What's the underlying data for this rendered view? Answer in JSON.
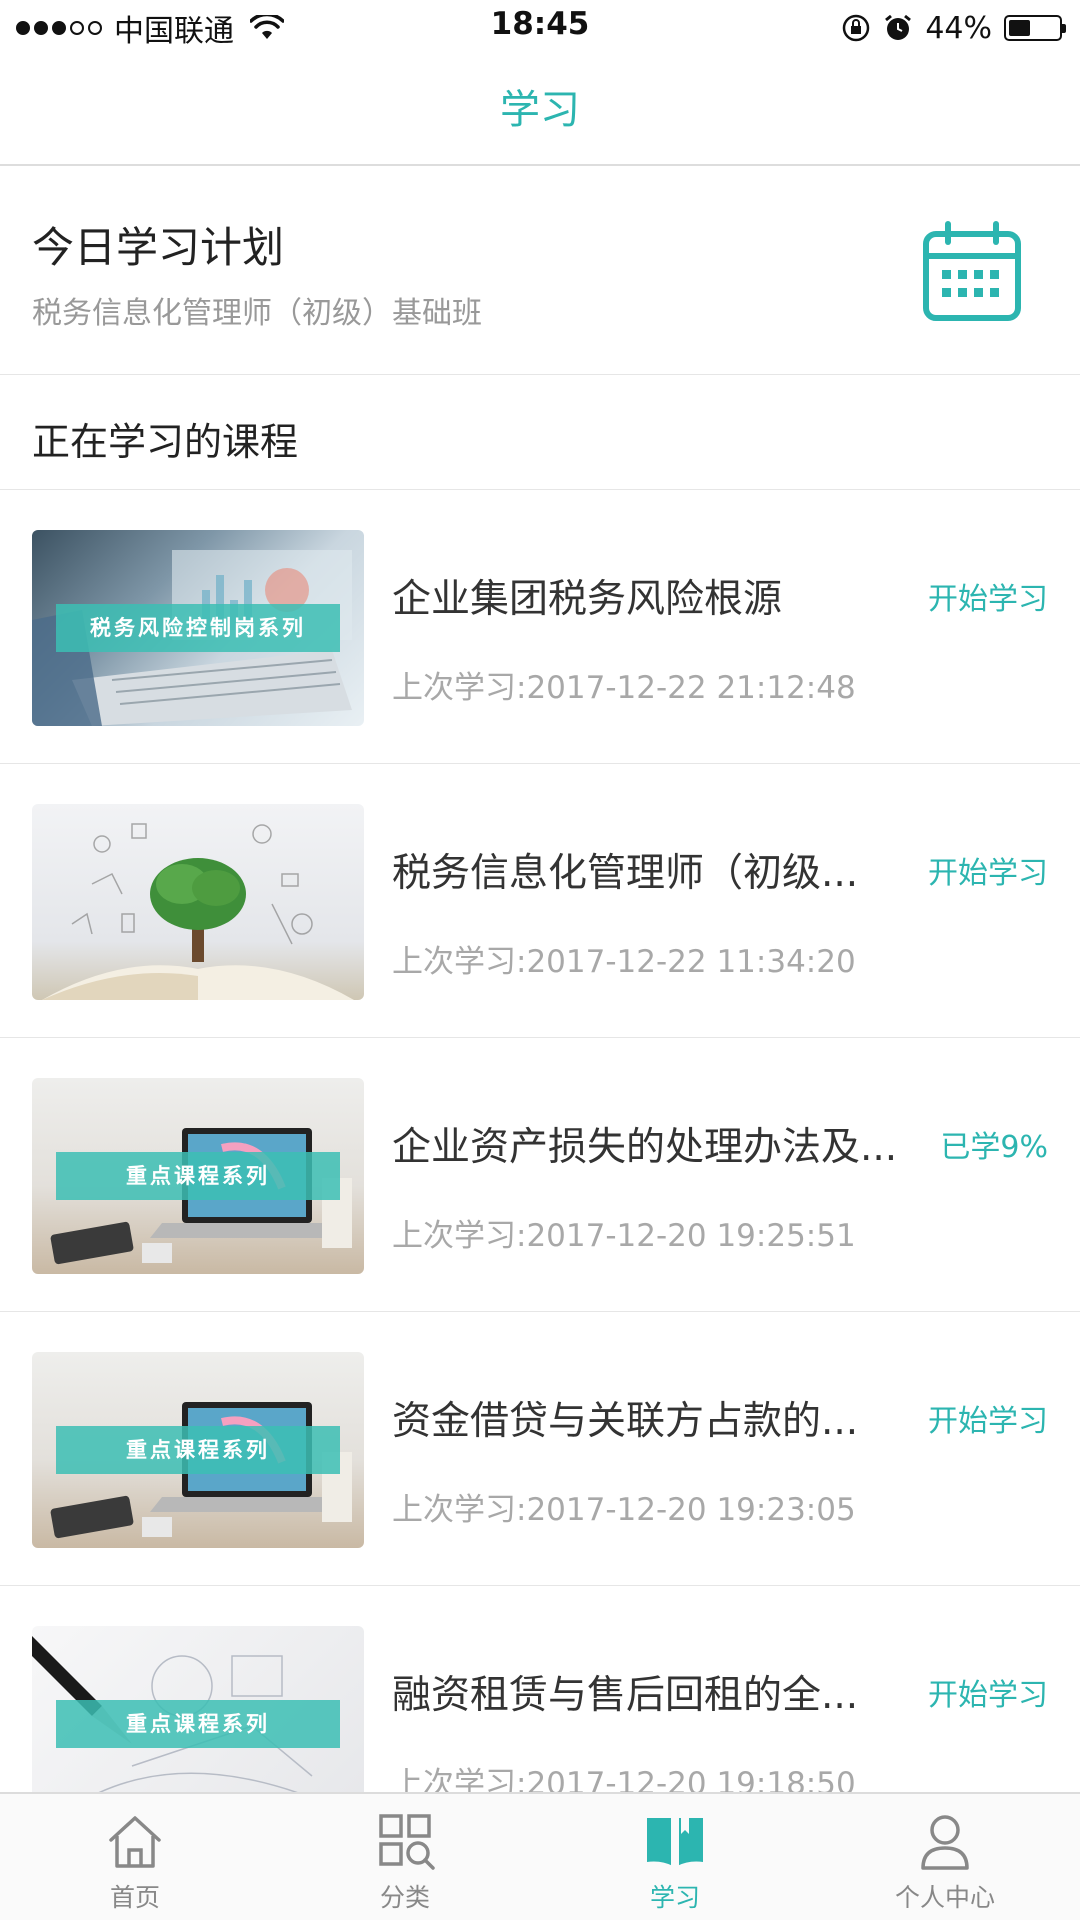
{
  "status": {
    "carrier": "中国联通",
    "time": "18:45",
    "battery": "44%",
    "battery_level": 0.44
  },
  "header": {
    "title": "学习"
  },
  "plan": {
    "title": "今日学习计划",
    "subtitle": "税务信息化管理师（初级）基础班",
    "icon": "calendar-icon"
  },
  "section": {
    "title": "正在学习的课程"
  },
  "courses": [
    {
      "name": "企业集团税务风险根源",
      "action": "开始学习",
      "last": "上次学习:2017-12-22 21:12:48",
      "ribbon": "税务风险控制岗系列"
    },
    {
      "name": "税务信息化管理师（初级...",
      "action": "开始学习",
      "last": "上次学习:2017-12-22 11:34:20",
      "ribbon": ""
    },
    {
      "name": "企业资产损失的处理办法及...",
      "action": "已学9%",
      "last": "上次学习:2017-12-20 19:25:51",
      "ribbon": "重点课程系列"
    },
    {
      "name": "资金借贷与关联方占款的...",
      "action": "开始学习",
      "last": "上次学习:2017-12-20 19:23:05",
      "ribbon": "重点课程系列"
    },
    {
      "name": "融资租赁与售后回租的全...",
      "action": "开始学习",
      "last": "上次学习:2017-12-20 19:18:50",
      "ribbon": "重点课程系列"
    }
  ],
  "tabs": [
    {
      "label": "首页",
      "icon": "home-icon"
    },
    {
      "label": "分类",
      "icon": "category-icon"
    },
    {
      "label": "学习",
      "icon": "book-icon"
    },
    {
      "label": "个人中心",
      "icon": "person-icon"
    }
  ],
  "colors": {
    "accent": "#2cb5b0",
    "muted": "#a8a8a8",
    "text": "#333333"
  }
}
